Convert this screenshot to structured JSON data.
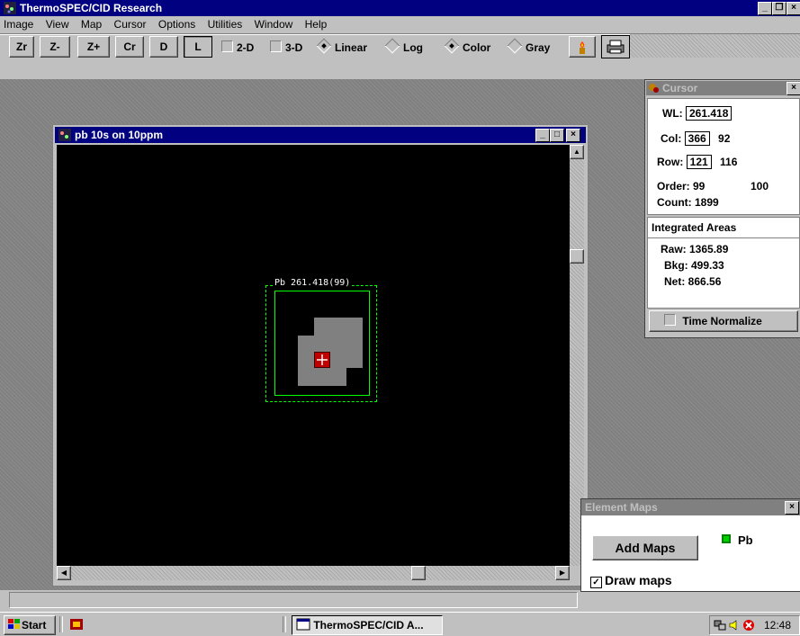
{
  "app": {
    "title": "ThermoSPEC/CID Research"
  },
  "menu": [
    "Image",
    "View",
    "Map",
    "Cursor",
    "Options",
    "Utilities",
    "Window",
    "Help"
  ],
  "toolbar": {
    "zr": "Zr",
    "zminus": "Z-",
    "zplus": "Z+",
    "cr": "Cr",
    "d": "D",
    "l": "L",
    "twod": "2-D",
    "threed": "3-D",
    "linear": "Linear",
    "log": "Log",
    "color": "Color",
    "gray": "Gray"
  },
  "image_window": {
    "title": "pb 10s on 10ppm",
    "overlay_label": "Pb 261.418(99)"
  },
  "cursor_panel": {
    "title": "Cursor",
    "wl_label": "WL:",
    "wl_value": "261.418",
    "col_label": "Col:",
    "col_value": "366",
    "col_extra": "92",
    "row_label": "Row:",
    "row_value": "121",
    "row_extra": "116",
    "order_label": "Order: 99",
    "order_extra": "100",
    "count_label": "Count: 1899",
    "integrated_title": "Integrated Areas",
    "raw": "Raw: 1365.89",
    "bkg": "Bkg: 499.33",
    "net": "Net: 866.56",
    "time_normalize": "Time Normalize"
  },
  "element_maps": {
    "title": "Element Maps",
    "add_button": "Add Maps",
    "element": "Pb",
    "element_color": "#00a000",
    "draw_maps": "Draw maps",
    "draw_maps_checked": true
  },
  "taskbar": {
    "start": "Start",
    "task": "ThermoSPEC/CID A...",
    "clock": "12:48"
  },
  "colors": {
    "title_active": "#000080",
    "title_inactive": "#808080",
    "desktop": "#c0c0c0",
    "roi": "#00ff00"
  }
}
